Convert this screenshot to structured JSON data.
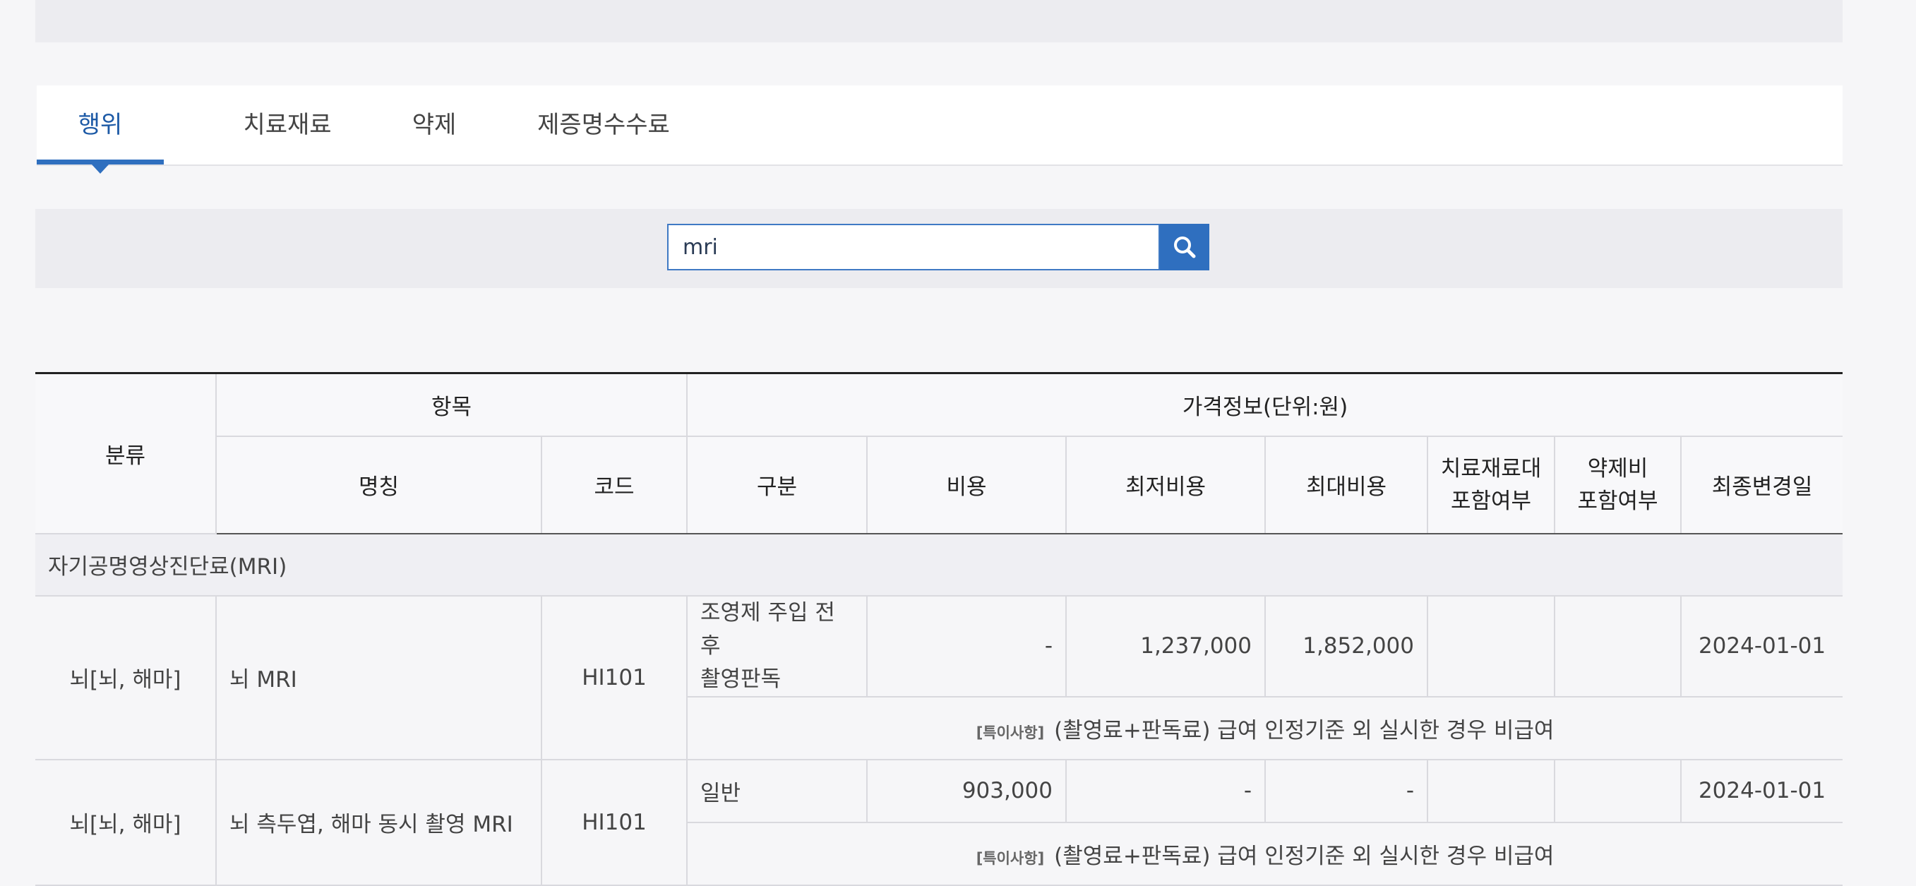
{
  "tabs": [
    {
      "label": "행위",
      "active": true
    },
    {
      "label": "치료재료",
      "active": false
    },
    {
      "label": "약제",
      "active": false
    },
    {
      "label": "제증명수수료",
      "active": false
    }
  ],
  "search": {
    "value": "mri",
    "button_icon": "search-icon"
  },
  "colors": {
    "accent": "#2f6fbf",
    "active_tab_text": "#1d5aa6"
  },
  "table": {
    "headers": {
      "category": "분류",
      "item_group": "항목",
      "price_group": "가격정보(단위:원)",
      "name": "명칭",
      "code": "코드",
      "type": "구분",
      "cost": "비용",
      "min_cost": "최저비용",
      "max_cost": "최대비용",
      "material_included": "치료재료대\n포함여부",
      "drug_included": "약제비\n포함여부",
      "last_modified": "최종변경일"
    },
    "group_label": "자기공명영상진단료(MRI)",
    "rows": [
      {
        "category": "뇌[뇌, 해마]",
        "name": "뇌 MRI",
        "code": "HI101",
        "type": "조영제 주입 전후\n촬영판독",
        "cost": "-",
        "min_cost": "1,237,000",
        "max_cost": "1,852,000",
        "material_included": "",
        "drug_included": "",
        "last_modified": "2024-01-01",
        "note_tag": "[특이사항]",
        "note": "(촬영료+판독료) 급여 인정기준 외 실시한 경우 비급여"
      },
      {
        "category": "뇌[뇌, 해마]",
        "name": "뇌 측두엽, 해마 동시 촬영 MRI",
        "code": "HI101",
        "type": "일반",
        "cost": "903,000",
        "min_cost": "-",
        "max_cost": "-",
        "material_included": "",
        "drug_included": "",
        "last_modified": "2024-01-01",
        "note_tag": "[특이사항]",
        "note": "(촬영료+판독료) 급여 인정기준 외 실시한 경우 비급여"
      }
    ]
  }
}
